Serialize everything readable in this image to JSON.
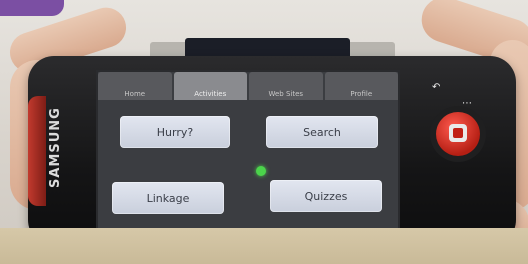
{
  "device": {
    "brand": "SAMSUNG"
  },
  "app": {
    "tabs": [
      {
        "label": "Home",
        "active": false
      },
      {
        "label": "Activities",
        "active": true
      },
      {
        "label": "Web Sites",
        "active": false
      },
      {
        "label": "Profile",
        "active": false
      }
    ],
    "buttons": {
      "hurry": "Hurry?",
      "search": "Search",
      "linkage": "Linkage",
      "quizzes": "Quizzes"
    },
    "status_dot_color": "#4bd44b"
  },
  "icons": {
    "back": "back-icon",
    "menu": "menu-icon",
    "hardware_button": "phone-button-icon"
  }
}
